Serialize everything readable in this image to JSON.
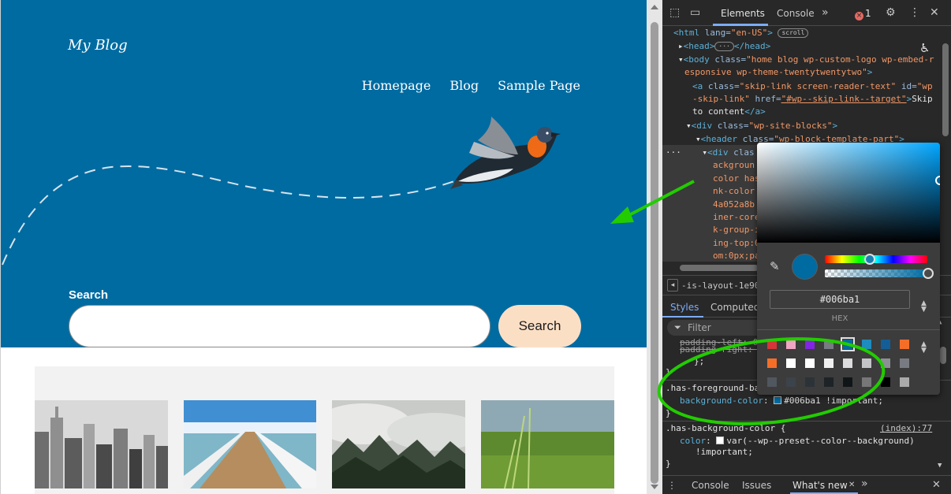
{
  "site": {
    "title": "My Blog",
    "nav": [
      "Homepage",
      "Blog",
      "Sample Page"
    ],
    "search_label": "Search",
    "search_placeholder": "",
    "search_button": "Search",
    "hero_color": "#006ba1",
    "button_color": "#fbdfc5"
  },
  "devtools": {
    "tabs": {
      "elements": "Elements",
      "console": "Console",
      "more": "»"
    },
    "error_count": "1",
    "dom": {
      "l1_tag": "<html",
      "l1_attr": " lang=",
      "l1_val": "\"en-US\"",
      "l1_close": ">",
      "scroll_badge": "scroll",
      "l2": "<head>",
      "l2_end": "</head>",
      "l3_open": "<body",
      "l3_attr": " class=",
      "l3_val": "\"home blog wp-custom-logo wp-embed-r",
      "l3b_val": "esponsive wp-theme-twentytwentytwo\"",
      "l3b_close": ">",
      "l4_open": "<a",
      "l4_attr": " class=",
      "l4_val": "\"skip-link screen-reader-text\"",
      "l4_attr2": " id=",
      "l4_val2": "\"wp",
      "l4b_val": "-skip-link\"",
      "l4b_attr": " href=",
      "l4b_val2": "\"#wp--skip-link--target\"",
      "l4b_close": ">",
      "l4b_text": "Skip",
      "l4c_text": "to content",
      "l4c_close": "</a>",
      "l5_open": "<div",
      "l5_attr": " class=",
      "l5_val": "\"wp-site-blocks\"",
      "l5_close": ">",
      "l6_open": "<header",
      "l6_attr": " class=",
      "l6_val": "\"wp-block-template-part\"",
      "l6_close": ">",
      "l7_open": "<div",
      "l7_attr": " clas",
      "frag": [
        "ackgroun",
        "color has",
        "nk-color",
        "4a052a8b",
        "iner-core",
        "k-group-i",
        "ing-top:0",
        "om:0px;pa"
      ]
    },
    "breadcrumb": "-is-layout-1e90f30",
    "style_tabs": {
      "styles": "Styles",
      "computed": "Computed"
    },
    "filter_placeholder": "Filter",
    "css": {
      "strike1": "padding-left: 0",
      "strike2": "padding-right: 0",
      "brace_close": "};",
      "brace": "}",
      "rule1_selector": ".has-foreground-ba",
      "rule1_prop": "background-color",
      "rule1_value": "#006ba1 !important;",
      "rule2_selector": ".has-background-color {",
      "rule2_source": "(index):77",
      "rule2_prop": "color",
      "rule2_value": "var(--wp--preset--color--background)",
      "rule2_value2": "!important;",
      "swatch_blue": "#006ba1",
      "swatch_white": "#ffffff"
    },
    "drawer_tabs": [
      "Console",
      "Issues",
      "What's new"
    ]
  },
  "picker": {
    "hex_value": "#006ba1",
    "format_label": "HEX",
    "current_color": "#006ba1",
    "palette": [
      [
        "#d63638",
        "#f0a5c2",
        "#8224e3",
        "#787c82",
        "#006ba1",
        "#1e8cbe",
        "#135e96",
        "#f56e28"
      ],
      [
        "#f56e28",
        "#ffffff",
        "#ffffff",
        "#f0f0f0",
        "#dcdcde",
        "#c3c4c7",
        "#8c8f94",
        "#787c82"
      ],
      [
        "#50575e",
        "#3c434a",
        "#2c3338",
        "#1d2327",
        "#101517",
        "#777777",
        "#000000",
        "#aaaaaa"
      ]
    ]
  },
  "annotation": {
    "color": "#22cc00"
  }
}
